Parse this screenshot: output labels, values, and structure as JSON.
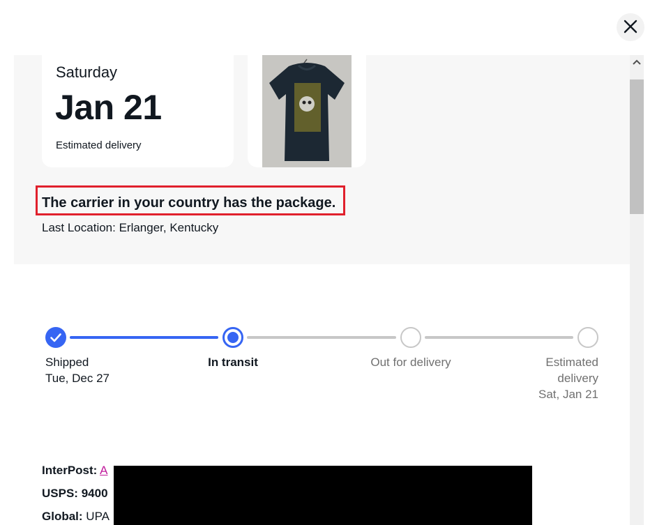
{
  "summary": {
    "day": "Saturday",
    "date": "Jan 21",
    "estimated_label": "Estimated delivery",
    "status": "The carrier in your country has the package.",
    "last_location": "Last Location: Erlanger, Kentucky"
  },
  "tracker": {
    "steps": [
      {
        "title": "Shipped",
        "sub": "Tue, Dec 27",
        "state": "done"
      },
      {
        "title": "In transit",
        "sub": "",
        "state": "current"
      },
      {
        "title": "Out for delivery",
        "sub": "",
        "state": "pending"
      },
      {
        "title": "Estimated",
        "title2": "delivery",
        "sub": "Sat, Jan 21",
        "state": "pending"
      }
    ],
    "colors": {
      "active": "#3665f3",
      "inactive": "#c7c7c7",
      "muted_text": "#707070"
    }
  },
  "carriers": [
    {
      "label": "InterPost:",
      "value": "A",
      "link": true
    },
    {
      "label": "USPS:",
      "value": "9400",
      "link": false
    },
    {
      "label": "Global:",
      "value": "UPA",
      "link": false
    }
  ],
  "icons": {
    "close": "close-icon",
    "scroll_up": "chevron-up-icon",
    "check": "check-icon"
  }
}
